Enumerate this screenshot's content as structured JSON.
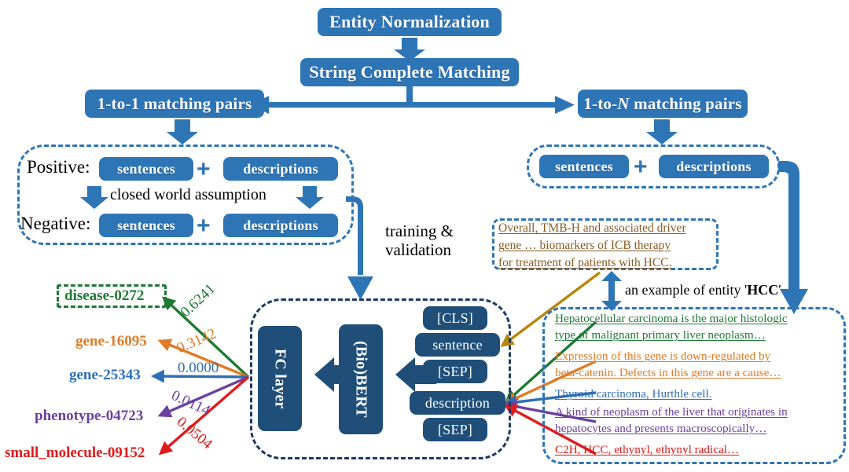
{
  "diagram": {
    "title": "Entity Normalization pipeline",
    "colors": {
      "box_blue": "#2e75b6",
      "box_navy": "#1f4e79",
      "dash_blue": "#2e75b6",
      "dash_navy": "#1f3864",
      "green": "#1e7a33",
      "orange": "#e07b28",
      "blue": "#2e6fb7",
      "purple": "#6b3fa0",
      "red": "#e01b1b",
      "gold": "#b8860b",
      "brown": "#8a5a24"
    }
  },
  "top": {
    "entity_normalization": "Entity Normalization",
    "string_complete_matching": "String Complete Matching",
    "one_to_one": "1-to-1 matching pairs",
    "one_to_n_prefix": "1-to-",
    "one_to_n_italic": "N",
    "one_to_n_suffix": " matching pairs"
  },
  "left_panel": {
    "positive_label": "Positive:",
    "negative_label": "Negative:",
    "sentences": "sentences",
    "descriptions": "descriptions",
    "plus": "+",
    "assumption": "closed world assumption",
    "training_validation": "training &\nvalidation"
  },
  "right_panel": {
    "sentences": "sentences",
    "descriptions": "descriptions",
    "plus": "+",
    "sentence_box": [
      "Overall, TMB-H and associated driver",
      "gene  …  biomarkers  of  ICB  therapy",
      "for treatment of patients with HCC."
    ],
    "example_prefix": "an example of entity '",
    "example_entity": "HCC",
    "example_suffix": "'",
    "candidates": [
      {
        "color_key": "green",
        "lines": [
          "Hepatocellular carcinoma is the major histologic",
          "type of malignant primary liver neoplasm…"
        ]
      },
      {
        "color_key": "orange",
        "lines": [
          "Expression of this gene is down-regulated by",
          "beta-catenin. Defects in this gene are a cause…"
        ]
      },
      {
        "color_key": "blue",
        "lines": [
          "Thyroid carcinoma, Hurthle cell."
        ]
      },
      {
        "color_key": "purple",
        "lines": [
          "A kind of neoplasm of the liver that originates in",
          "hepatocytes and presents macroscopically…"
        ]
      },
      {
        "color_key": "red",
        "lines": [
          "C2H, HCC, ethynyl, ethynyl radical…"
        ]
      }
    ]
  },
  "model": {
    "fc_layer": "FC layer",
    "biobert": "(Bio)BERT",
    "tokens": [
      "[CLS]",
      "sentence",
      "[SEP]",
      "description",
      "[SEP]"
    ]
  },
  "predictions": [
    {
      "entity": "disease-0272",
      "score": "0.6241",
      "color_key": "green",
      "boxed": true
    },
    {
      "entity": "gene-16095",
      "score": "0.3142",
      "color_key": "orange",
      "boxed": false
    },
    {
      "entity": "gene-25343",
      "score": "0.0000",
      "color_key": "blue",
      "boxed": false
    },
    {
      "entity": "phenotype-04723",
      "score": "0.0114",
      "color_key": "purple",
      "boxed": false
    },
    {
      "entity": "small_molecule-09152",
      "score": "0.0504",
      "color_key": "red",
      "boxed": false
    }
  ]
}
